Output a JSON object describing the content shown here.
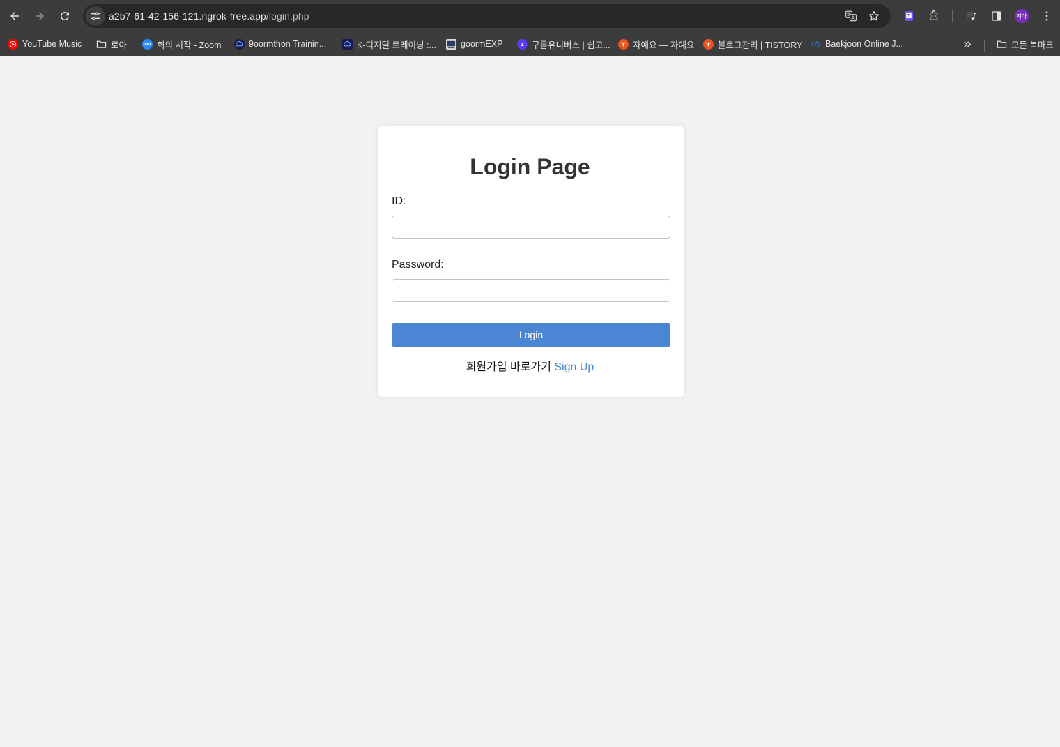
{
  "browser": {
    "url_host": "a2b7-61-42-156-121.ngrok-free.app",
    "url_path": "/login.php",
    "profile_initials": "지아",
    "bookmarks": [
      {
        "label": "YouTube Music",
        "icon": "youtube-music-icon",
        "color": "#ff0000"
      },
      {
        "label": "로아",
        "icon": "folder-icon"
      },
      {
        "label": "회의 시작 - Zoom",
        "icon": "zoom-icon",
        "color": "#2d8cff"
      },
      {
        "label": "9oormthon Trainin...",
        "icon": "goorm-icon",
        "color": "#1a1a4a"
      },
      {
        "label": "K-디지털 트레이닝 :...",
        "icon": "goorm-icon",
        "color": "#1a1a4a"
      },
      {
        "label": "goormEXP",
        "icon": "goormexp-icon"
      },
      {
        "label": "구름유니버스 | 쉽고...",
        "icon": "goorm-universe-icon",
        "color": "#5b3bff"
      },
      {
        "label": "자예요 — 자예요",
        "icon": "tistory-icon",
        "color": "#eb531f"
      },
      {
        "label": "블로그관리 | TISTORY",
        "icon": "tistory-icon",
        "color": "#eb531f"
      },
      {
        "label": "Baekjoon Online J...",
        "icon": "baekjoon-icon",
        "color": "#2e6ed1"
      }
    ],
    "all_bookmarks_label": "모든 북마크"
  },
  "page": {
    "title": "Login Page",
    "id_label": "ID:",
    "id_value": "",
    "password_label": "Password:",
    "password_value": "",
    "login_button": "Login",
    "signup_prompt": "회원가입 바로가기",
    "signup_link": "Sign Up"
  },
  "colors": {
    "accent": "#4a86d4",
    "page_background": "#f2f2f2",
    "chrome_background": "#3c3c3c"
  }
}
